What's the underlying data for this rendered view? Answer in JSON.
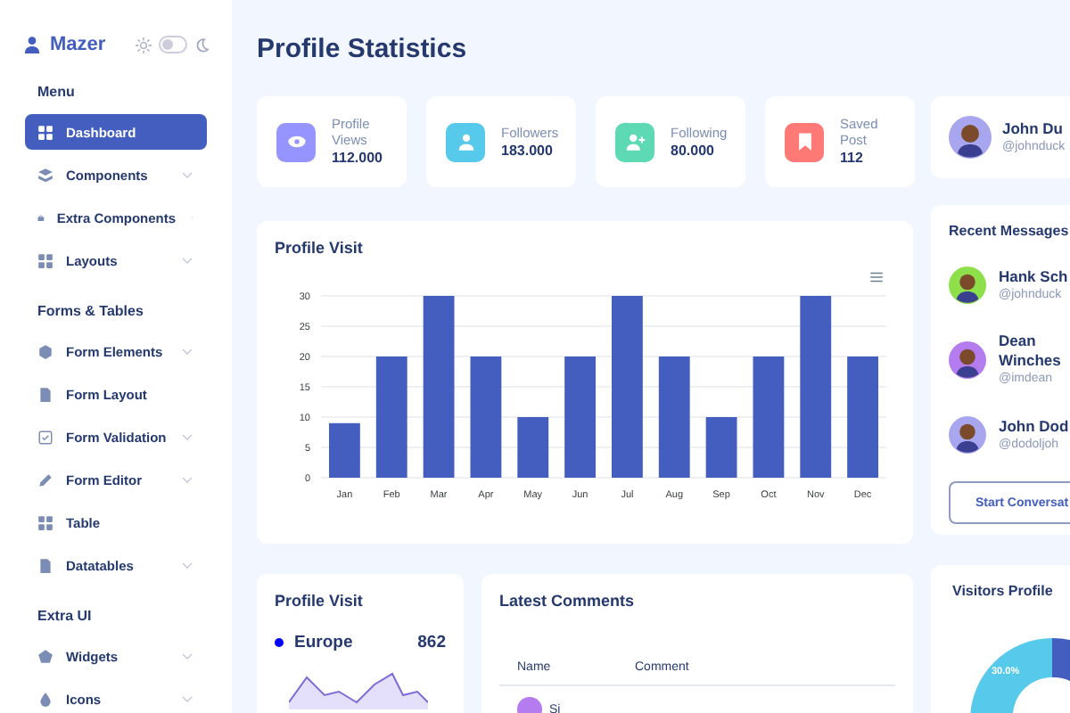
{
  "brand": {
    "name": "Mazer"
  },
  "theme_toggle": {
    "on": false
  },
  "sidebar": {
    "groups": [
      {
        "title": "Menu",
        "items": [
          {
            "label": "Dashboard",
            "kind": "grid",
            "selected": true,
            "submenu": false
          },
          {
            "label": "Components",
            "kind": "stack",
            "selected": false,
            "submenu": true
          },
          {
            "label": "Extra Components",
            "kind": "case",
            "selected": false,
            "submenu": true
          },
          {
            "label": "Layouts",
            "kind": "grid",
            "selected": false,
            "submenu": true
          }
        ]
      },
      {
        "title": "Forms & Tables",
        "items": [
          {
            "label": "Form Elements",
            "kind": "hex",
            "selected": false,
            "submenu": true
          },
          {
            "label": "Form Layout",
            "kind": "doc",
            "selected": false,
            "submenu": false
          },
          {
            "label": "Form Validation",
            "kind": "check",
            "selected": false,
            "submenu": true
          },
          {
            "label": "Form Editor",
            "kind": "pen",
            "selected": false,
            "submenu": true
          },
          {
            "label": "Table",
            "kind": "grid",
            "selected": false,
            "submenu": false
          },
          {
            "label": "Datatables",
            "kind": "doc",
            "selected": false,
            "submenu": true
          }
        ]
      },
      {
        "title": "Extra UI",
        "items": [
          {
            "label": "Widgets",
            "kind": "pent",
            "selected": false,
            "submenu": true
          },
          {
            "label": "Icons",
            "kind": "drop",
            "selected": false,
            "submenu": true
          }
        ]
      }
    ]
  },
  "page_title": "Profile Statistics",
  "stats": [
    {
      "label": "Profile Views",
      "value": "112.000",
      "kind": "eye",
      "color": "#9694ff"
    },
    {
      "label": "Followers",
      "value": "183.000",
      "kind": "user",
      "color": "#57caeb"
    },
    {
      "label": "Following",
      "value": "80.000",
      "kind": "user-plus",
      "color": "#5ddab4"
    },
    {
      "label": "Saved Post",
      "value": "112",
      "kind": "bookmark",
      "color": "#ff7976"
    }
  ],
  "profile": {
    "name": "John Du",
    "handle": "@johnduck"
  },
  "profile_visit_chart": {
    "title": "Profile Visit",
    "chart_data": {
      "type": "bar",
      "categories": [
        "Jan",
        "Feb",
        "Mar",
        "Apr",
        "May",
        "Jun",
        "Jul",
        "Aug",
        "Sep",
        "Oct",
        "Nov",
        "Dec"
      ],
      "grid": true,
      "series": [
        {
          "color": "#435ebe",
          "values": [
            9,
            20,
            30,
            20,
            10,
            20,
            30,
            20,
            10,
            20,
            30,
            20
          ]
        }
      ],
      "ylim": [
        0,
        30
      ],
      "yticks": [
        0,
        5,
        10,
        15,
        20,
        25,
        30
      ]
    }
  },
  "recent_messages": {
    "title": "Recent Messages",
    "items": [
      {
        "name": "Hank Sch",
        "handle": "@johnduck",
        "color": "#8ee04a"
      },
      {
        "name": "Dean Winches",
        "handle": "@imdean",
        "color": "#b57cf0"
      },
      {
        "name": "John Dod",
        "handle": "@dodoljoh",
        "color": "#a9a6f0"
      }
    ],
    "button": "Start Conversat"
  },
  "region_visit": {
    "title": "Profile Visit",
    "regions": [
      {
        "name": "Europe",
        "value": "862"
      }
    ]
  },
  "latest_comments": {
    "title": "Latest Comments",
    "columns": [
      "Name",
      "Comment"
    ],
    "rows": [
      {
        "name": "Si"
      }
    ]
  },
  "visitors_profile": {
    "title": "Visitors Profile",
    "slice_label": "30.0%"
  }
}
